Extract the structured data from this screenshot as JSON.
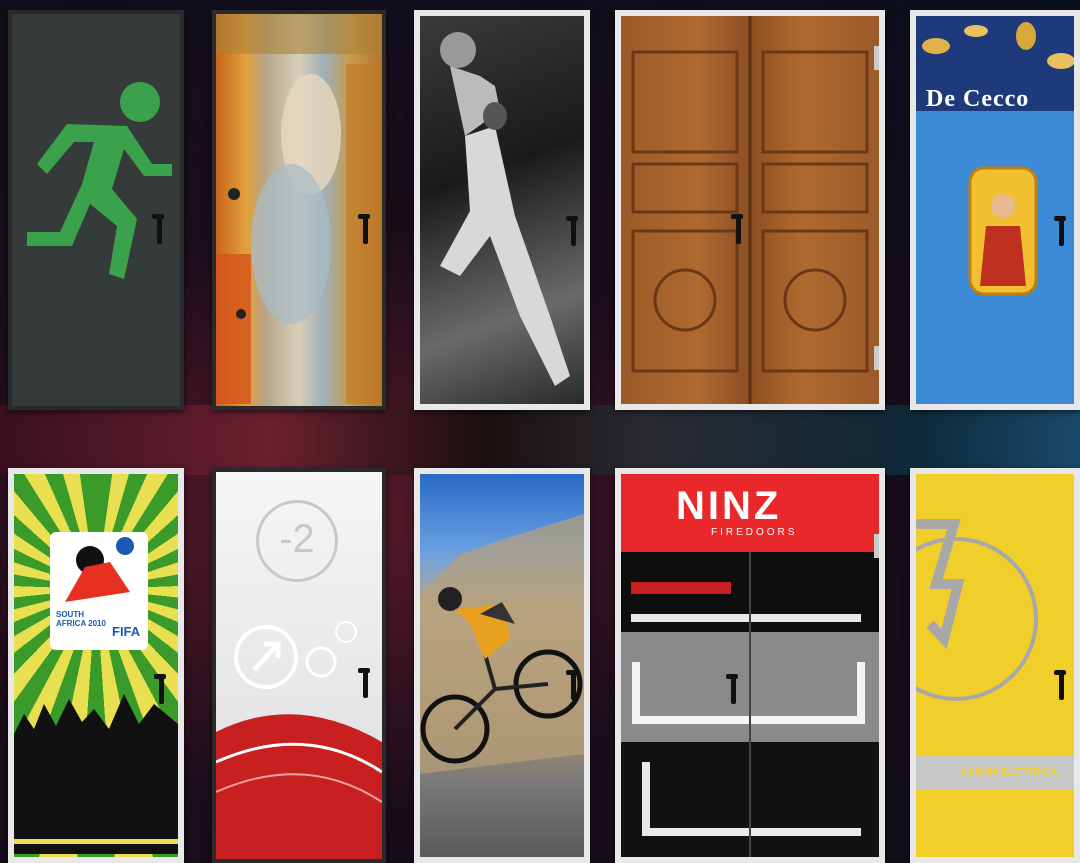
{
  "doors_top": [
    {
      "name": "exit-door"
    },
    {
      "name": "klimt-art-door"
    },
    {
      "name": "basketball-door"
    },
    {
      "name": "wood-double-door"
    },
    {
      "name": "de-cecco-door",
      "brand_text": "De Cecco"
    }
  ],
  "doors_bottom": [
    {
      "name": "world-cup-door",
      "fifa_text": "FIFA",
      "badge_text": "SOUTH AFRICA 2010"
    },
    {
      "name": "floor-minus-two-door",
      "floor_text": "-2"
    },
    {
      "name": "mountain-bike-door"
    },
    {
      "name": "ninz-firedoors-door",
      "brand_text": "NINZ",
      "brand_sub": "FIREDOORS"
    },
    {
      "name": "electrical-cabin-door",
      "sign_text": "CABINA ELETTRICA"
    }
  ],
  "colors": {
    "exit_green": "#3aa24a",
    "de_cecco_blue": "#3d8ad6",
    "ninz_red": "#e8282a",
    "cabin_yellow": "#f1cf2b"
  }
}
